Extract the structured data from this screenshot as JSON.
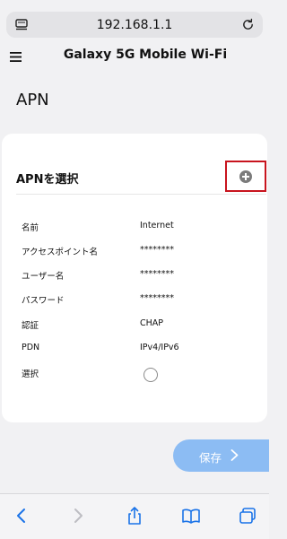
{
  "browser": {
    "url": "192.168.1.1",
    "icons": [
      "reader-icon",
      "reload-icon"
    ]
  },
  "header": {
    "title": "Galaxy 5G Mobile Wi-Fi",
    "menu_icon": "hamburger-menu-icon"
  },
  "page": {
    "title": "APN"
  },
  "card": {
    "title": "APNを選択",
    "add_icon": "plus-circle-icon",
    "rows": [
      {
        "label": "名前",
        "value": "Internet"
      },
      {
        "label": "アクセスポイント名",
        "value": "********"
      },
      {
        "label": "ユーザー名",
        "value": "********"
      },
      {
        "label": "パスワード",
        "value": "********"
      },
      {
        "label": "認証",
        "value": "CHAP"
      },
      {
        "label": "PDN",
        "value": "IPv4/IPv6"
      },
      {
        "label": "選択",
        "value": ""
      }
    ],
    "select_radio_checked": false
  },
  "actions": {
    "save_label": "保存",
    "save_color": "#8cbcf3"
  },
  "toolbar": {
    "icons": [
      "back-icon",
      "forward-icon",
      "share-icon",
      "bookmarks-icon",
      "tabs-icon"
    ]
  },
  "colors": {
    "highlight_border": "#c8141e",
    "accent": "#1a73e8"
  }
}
